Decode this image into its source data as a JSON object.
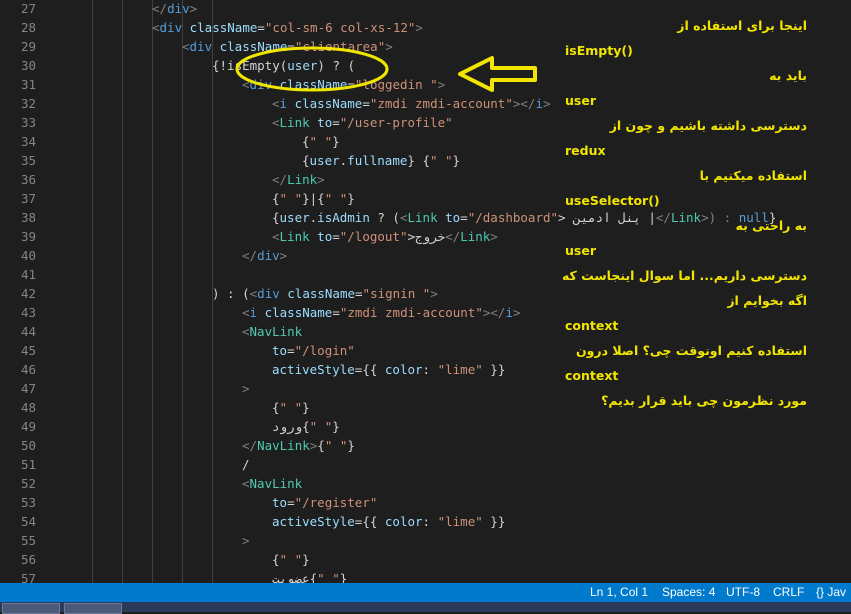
{
  "editor": {
    "lines": [
      {
        "n": "27",
        "indent": 6,
        "tokens": [
          [
            "</",
            "punc"
          ],
          [
            "div",
            "tag"
          ],
          [
            ">",
            "punc"
          ]
        ]
      },
      {
        "n": "28",
        "indent": 6,
        "tokens": [
          [
            "<",
            "punc"
          ],
          [
            "div",
            "tag"
          ],
          [
            " className",
            "attr"
          ],
          [
            "=",
            "txt"
          ],
          [
            "\"col-sm-6 col-xs-12\"",
            "str"
          ],
          [
            ">",
            "punc"
          ]
        ]
      },
      {
        "n": "29",
        "indent": 8,
        "tokens": [
          [
            "<",
            "punc"
          ],
          [
            "div",
            "tag"
          ],
          [
            " className",
            "attr"
          ],
          [
            "=",
            "txt"
          ],
          [
            "\"clientarea\"",
            "str"
          ],
          [
            ">",
            "punc"
          ]
        ]
      },
      {
        "n": "30",
        "indent": 10,
        "tokens": [
          [
            "{",
            "txt"
          ],
          [
            "!isEmpty",
            "txt"
          ],
          [
            "(",
            "txt"
          ],
          [
            "user",
            "attr"
          ],
          [
            ") ? (",
            "txt"
          ]
        ]
      },
      {
        "n": "31",
        "indent": 12,
        "tokens": [
          [
            "<",
            "punc"
          ],
          [
            "div",
            "tag"
          ],
          [
            " className",
            "attr"
          ],
          [
            "=",
            "txt"
          ],
          [
            "\"loggedin \"",
            "str"
          ],
          [
            ">",
            "punc"
          ]
        ]
      },
      {
        "n": "32",
        "indent": 14,
        "tokens": [
          [
            "<",
            "punc"
          ],
          [
            "i",
            "tag"
          ],
          [
            " className",
            "attr"
          ],
          [
            "=",
            "txt"
          ],
          [
            "\"zmdi zmdi-account\"",
            "str"
          ],
          [
            "></",
            "punc"
          ],
          [
            "i",
            "tag"
          ],
          [
            ">",
            "punc"
          ]
        ]
      },
      {
        "n": "33",
        "indent": 14,
        "tokens": [
          [
            "<",
            "punc"
          ],
          [
            "Link",
            "cmp"
          ],
          [
            " to",
            "attr"
          ],
          [
            "=",
            "txt"
          ],
          [
            "\"/user-profile\"",
            "str"
          ]
        ]
      },
      {
        "n": "34",
        "indent": 16,
        "tokens": [
          [
            "{",
            "txt"
          ],
          [
            "\" \"",
            "str"
          ],
          [
            "}",
            "txt"
          ]
        ]
      },
      {
        "n": "35",
        "indent": 16,
        "tokens": [
          [
            "{",
            "txt"
          ],
          [
            "user",
            "attr"
          ],
          [
            ".",
            "txt"
          ],
          [
            "fullname",
            "attr"
          ],
          [
            "} {",
            "txt"
          ],
          [
            "\" \"",
            "str"
          ],
          [
            "}",
            "txt"
          ]
        ]
      },
      {
        "n": "36",
        "indent": 14,
        "tokens": [
          [
            "</",
            "punc"
          ],
          [
            "Link",
            "cmp"
          ],
          [
            ">",
            "punc"
          ]
        ]
      },
      {
        "n": "37",
        "indent": 14,
        "tokens": [
          [
            "{",
            "txt"
          ],
          [
            "\" \"",
            "str"
          ],
          [
            "}|{",
            "txt"
          ],
          [
            "\" \"",
            "str"
          ],
          [
            "}",
            "txt"
          ]
        ]
      },
      {
        "n": "38",
        "indent": 14,
        "tokens": [
          [
            "{",
            "txt"
          ],
          [
            "user",
            "attr"
          ],
          [
            ".",
            "txt"
          ],
          [
            "isAdmin",
            "attr"
          ],
          [
            " ? (",
            "txt"
          ],
          [
            "<",
            "punc"
          ],
          [
            "Link",
            "cmp"
          ],
          [
            " to",
            "attr"
          ],
          [
            "=",
            "txt"
          ],
          [
            "\"/dashboard\"",
            "str"
          ],
          [
            "> پنل ادمین |",
            "txt"
          ],
          [
            "</",
            "punc"
          ],
          [
            "Link",
            "cmp"
          ],
          [
            ">) : ",
            "punc"
          ],
          [
            "null",
            "tag"
          ],
          [
            "}",
            "txt"
          ]
        ]
      },
      {
        "n": "39",
        "indent": 14,
        "tokens": [
          [
            "<",
            "punc"
          ],
          [
            "Link",
            "cmp"
          ],
          [
            " to",
            "attr"
          ],
          [
            "=",
            "txt"
          ],
          [
            "\"/logout\"",
            "str"
          ],
          [
            ">خروج",
            "txt"
          ],
          [
            "</",
            "punc"
          ],
          [
            "Link",
            "cmp"
          ],
          [
            ">",
            "punc"
          ]
        ]
      },
      {
        "n": "40",
        "indent": 12,
        "tokens": [
          [
            "</",
            "punc"
          ],
          [
            "div",
            "tag"
          ],
          [
            ">",
            "punc"
          ]
        ]
      },
      {
        "n": "41",
        "indent": 0,
        "tokens": []
      },
      {
        "n": "42",
        "indent": 10,
        "tokens": [
          [
            ") : (",
            "txt"
          ],
          [
            "<",
            "punc"
          ],
          [
            "div",
            "tag"
          ],
          [
            " className",
            "attr"
          ],
          [
            "=",
            "txt"
          ],
          [
            "\"signin \"",
            "str"
          ],
          [
            ">",
            "punc"
          ]
        ]
      },
      {
        "n": "43",
        "indent": 12,
        "tokens": [
          [
            "<",
            "punc"
          ],
          [
            "i",
            "tag"
          ],
          [
            " className",
            "attr"
          ],
          [
            "=",
            "txt"
          ],
          [
            "\"zmdi zmdi-account\"",
            "str"
          ],
          [
            "></",
            "punc"
          ],
          [
            "i",
            "tag"
          ],
          [
            ">",
            "punc"
          ]
        ]
      },
      {
        "n": "44",
        "indent": 12,
        "tokens": [
          [
            "<",
            "punc"
          ],
          [
            "NavLink",
            "cmp"
          ]
        ]
      },
      {
        "n": "45",
        "indent": 14,
        "tokens": [
          [
            "to",
            "attr"
          ],
          [
            "=",
            "txt"
          ],
          [
            "\"/login\"",
            "str"
          ]
        ]
      },
      {
        "n": "46",
        "indent": 14,
        "tokens": [
          [
            "activeStyle",
            "attr"
          ],
          [
            "={{ ",
            "txt"
          ],
          [
            "color",
            "attr"
          ],
          [
            ": ",
            "txt"
          ],
          [
            "\"lime\"",
            "str"
          ],
          [
            " }}",
            "txt"
          ]
        ]
      },
      {
        "n": "47",
        "indent": 12,
        "tokens": [
          [
            ">",
            "punc"
          ]
        ]
      },
      {
        "n": "48",
        "indent": 14,
        "tokens": [
          [
            "{",
            "txt"
          ],
          [
            "\" \"",
            "str"
          ],
          [
            "}",
            "txt"
          ]
        ]
      },
      {
        "n": "49",
        "indent": 14,
        "tokens": [
          [
            "ورود",
            "txt"
          ],
          [
            "{",
            "txt"
          ],
          [
            "\" \"",
            "str"
          ],
          [
            "}",
            "txt"
          ]
        ]
      },
      {
        "n": "50",
        "indent": 12,
        "tokens": [
          [
            "</",
            "punc"
          ],
          [
            "NavLink",
            "cmp"
          ],
          [
            ">",
            "punc"
          ],
          [
            "{",
            "txt"
          ],
          [
            "\" \"",
            "str"
          ],
          [
            "}",
            "txt"
          ]
        ]
      },
      {
        "n": "51",
        "indent": 12,
        "tokens": [
          [
            "/",
            "txt"
          ]
        ]
      },
      {
        "n": "52",
        "indent": 12,
        "tokens": [
          [
            "<",
            "punc"
          ],
          [
            "NavLink",
            "cmp"
          ]
        ]
      },
      {
        "n": "53",
        "indent": 14,
        "tokens": [
          [
            "to",
            "attr"
          ],
          [
            "=",
            "txt"
          ],
          [
            "\"/register\"",
            "str"
          ]
        ]
      },
      {
        "n": "54",
        "indent": 14,
        "tokens": [
          [
            "activeStyle",
            "attr"
          ],
          [
            "={{ ",
            "txt"
          ],
          [
            "color",
            "attr"
          ],
          [
            ": ",
            "txt"
          ],
          [
            "\"lime\"",
            "str"
          ],
          [
            " }}",
            "txt"
          ]
        ]
      },
      {
        "n": "55",
        "indent": 12,
        "tokens": [
          [
            ">",
            "punc"
          ]
        ]
      },
      {
        "n": "56",
        "indent": 14,
        "tokens": [
          [
            "{",
            "txt"
          ],
          [
            "\" \"",
            "str"
          ],
          [
            "}",
            "txt"
          ]
        ]
      },
      {
        "n": "57",
        "indent": 14,
        "tokens": [
          [
            "عضویت",
            "txt"
          ],
          [
            "{",
            "txt"
          ],
          [
            "\" \"",
            "str"
          ],
          [
            "}",
            "txt"
          ]
        ]
      }
    ]
  },
  "annotation": [
    {
      "text": "اینجا برای استفاده از",
      "rtl": true
    },
    {
      "text": "isEmpty()",
      "rtl": false
    },
    {
      "text": "باید به",
      "rtl": true
    },
    {
      "text": "user",
      "rtl": false
    },
    {
      "text": "دسترسی داشته باشیم و چون از",
      "rtl": true
    },
    {
      "text": "redux",
      "rtl": false
    },
    {
      "text": "استفاده میکنیم با",
      "rtl": true
    },
    {
      "text": "useSelector()",
      "rtl": false
    },
    {
      "text": "به راحتی به",
      "rtl": true
    },
    {
      "text": "user",
      "rtl": false
    },
    {
      "text": "دسترسی داریم... اما سوال اینجاست که",
      "rtl": true
    },
    {
      "text": "اگه بخوایم از",
      "rtl": true
    },
    {
      "text": "context",
      "rtl": false
    },
    {
      "text": "استفاده کنیم اونوقت چی؟ اصلا درون",
      "rtl": true
    },
    {
      "text": "context",
      "rtl": false
    },
    {
      "text": "مورد نظرمون چی باید قرار بدیم؟",
      "rtl": true
    }
  ],
  "statusbar": {
    "position": "Ln 1, Col 1",
    "spaces": "Spaces: 4",
    "encoding": "UTF-8",
    "eol": "CRLF",
    "language": "{} Jav"
  },
  "colors": {
    "tag": "#569cd6",
    "attr": "#9cdcfe",
    "str": "#ce9178",
    "cmp": "#4ec9b0",
    "txt": "#d4d4d4",
    "punc": "#808080",
    "annotation": "#f2e600",
    "statusbar": "#007acc"
  }
}
